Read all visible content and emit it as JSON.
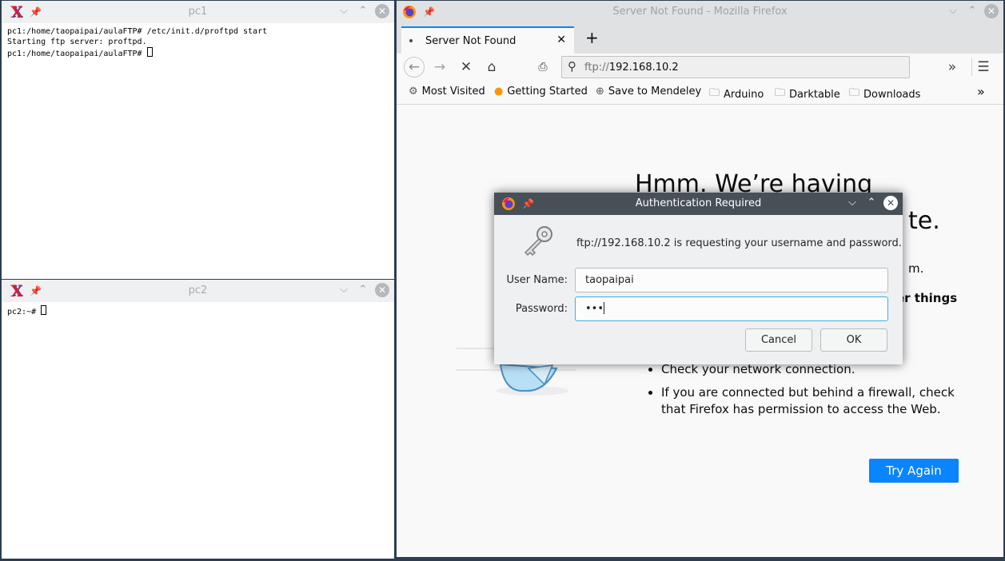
{
  "terminal1": {
    "title": "pc1",
    "lines": [
      "pc1:/home/taopaipai/aulaFTP# /etc/init.d/proftpd start",
      "Starting ftp server: proftpd.",
      "pc1:/home/taopaipai/aulaFTP# "
    ]
  },
  "terminal2": {
    "title": "pc2",
    "lines": [
      "pc2:~# "
    ]
  },
  "firefox": {
    "window_title": "Server Not Found - Mozilla Firefox",
    "tab_label": "Server Not Found",
    "url_scheme": "ftp://",
    "url_host": "192.168.10.2",
    "bookmarks": [
      "Most Visited",
      "Getting Started",
      "Save to Mendeley",
      "Arduino",
      "Darktable",
      "Downloads"
    ],
    "error": {
      "title_line1": "Hmm. We’re having",
      "title_line2": "te.",
      "p1": "m.",
      "p2": "er things",
      "list": [
        "Check your network connection.",
        "If you are connected but behind a firewall, check that Firefox has permission to access the Web."
      ],
      "try_again": "Try Again"
    }
  },
  "dialog": {
    "title": "Authentication Required",
    "message": "ftp://192.168.10.2 is requesting your username and password.",
    "username_label": "User Name:",
    "username_value": "taopaipai",
    "password_label": "Password:",
    "password_value": "•••",
    "cancel_label": "Cancel",
    "ok_label": "OK"
  }
}
